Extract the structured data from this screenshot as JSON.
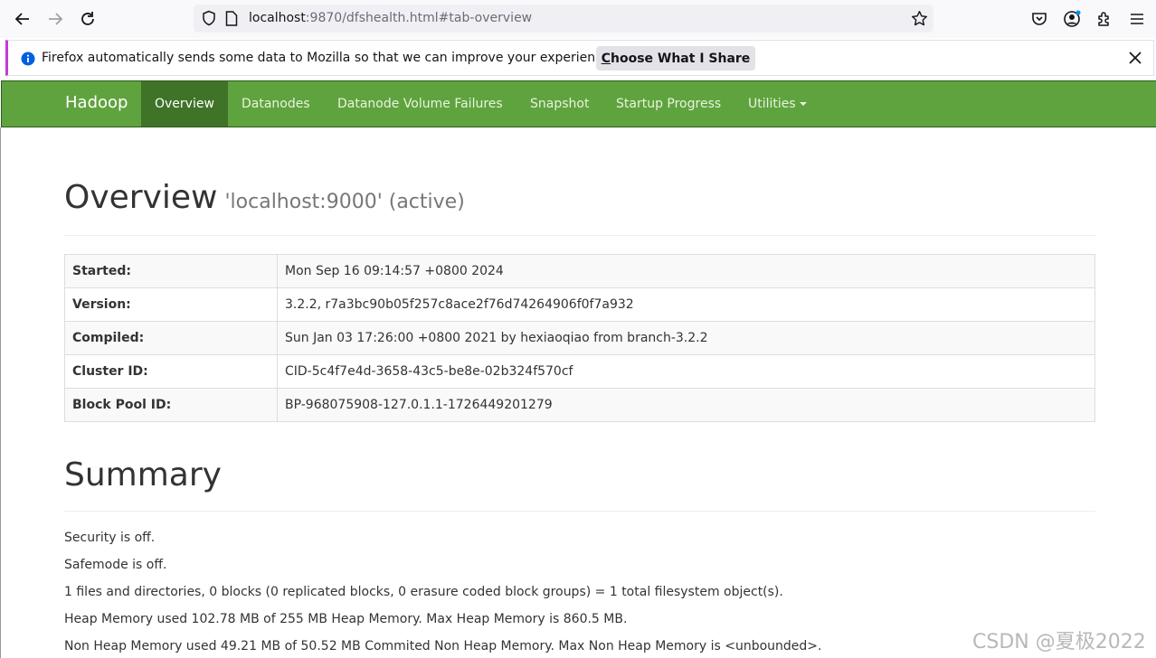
{
  "browser": {
    "url_host": "localhost",
    "url_rest": ":9870/dfshealth.html#tab-overview"
  },
  "notice": {
    "text": "Firefox automatically sends some data to Mozilla so that we can improve your experience.",
    "button_first_letter": "C",
    "button_rest": "hoose What I Share"
  },
  "navbar": {
    "brand": "Hadoop",
    "items": [
      {
        "label": "Overview",
        "active": true
      },
      {
        "label": "Datanodes"
      },
      {
        "label": "Datanode Volume Failures"
      },
      {
        "label": "Snapshot"
      },
      {
        "label": "Startup Progress"
      },
      {
        "label": "Utilities"
      }
    ]
  },
  "overview": {
    "title": "Overview",
    "subtitle": "'localhost:9000' (active)",
    "rows": [
      {
        "key": "Started:",
        "value": "Mon Sep 16 09:14:57 +0800 2024"
      },
      {
        "key": "Version:",
        "value": "3.2.2, r7a3bc90b05f257c8ace2f76d74264906f0f7a932"
      },
      {
        "key": "Compiled:",
        "value": "Sun Jan 03 17:26:00 +0800 2021 by hexiaoqiao from branch-3.2.2"
      },
      {
        "key": "Cluster ID:",
        "value": "CID-5c4f7e4d-3658-43c5-be8e-02b324f570cf"
      },
      {
        "key": "Block Pool ID:",
        "value": "BP-968075908-127.0.1.1-1726449201279"
      }
    ]
  },
  "summary": {
    "title": "Summary",
    "lines": [
      "Security is off.",
      "Safemode is off.",
      "1 files and directories, 0 blocks (0 replicated blocks, 0 erasure coded block groups) = 1 total filesystem object(s).",
      "Heap Memory used 102.78 MB of 255 MB Heap Memory. Max Heap Memory is 860.5 MB.",
      "Non Heap Memory used 49.21 MB of 50.52 MB Commited Non Heap Memory. Max Non Heap Memory is <unbounded>."
    ]
  },
  "watermark": "CSDN @夏极2022",
  "colors": {
    "navbar": "#5fa33e",
    "navbar_active": "#3f7327",
    "notice_accent": "#c33bd8",
    "info_icon": "#0060df"
  },
  "icons": [
    "back-arrow-icon",
    "forward-arrow-icon",
    "reload-icon",
    "shield-icon",
    "page-icon",
    "star-icon",
    "pocket-icon",
    "account-icon",
    "extensions-icon",
    "menu-icon",
    "info-icon",
    "close-icon",
    "caret-down-icon"
  ]
}
